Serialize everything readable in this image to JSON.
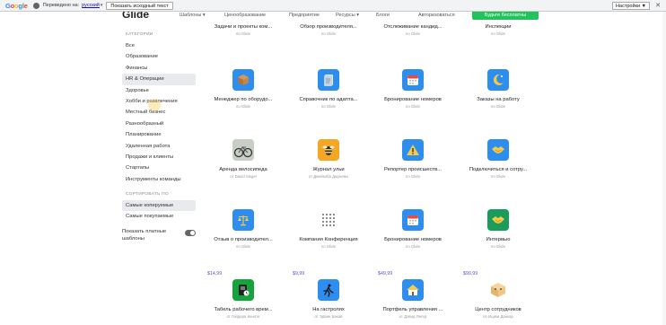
{
  "translate_bar": {
    "logo": [
      "G",
      "o",
      "o",
      "g",
      "l",
      "e"
    ],
    "status": "Переведено на:",
    "language": "русский",
    "show_original": "Показать исходный текст",
    "settings": "Настройки ▼",
    "close": "✕"
  },
  "nav": {
    "logo": "Glide",
    "items": [
      "Шаблоны ▾",
      "Ценообразование",
      "Предприятие",
      "Ресурсы ▾",
      "Блоги",
      "Авторизоваться"
    ],
    "cta": "Будьте бесплатны"
  },
  "sidebar": {
    "categories_heading": "КАТЕГОРИИ",
    "categories": [
      "Все",
      "Образование",
      "Финансы",
      "HR & Операции",
      "Здоровье",
      "Хобби и развлечения",
      "Местный бизнес",
      "Разнообразный",
      "Планирование",
      "Удаленная работа",
      "Продажи и клиенты",
      "Стартапы",
      "Инструменты команды"
    ],
    "active_category": "HR & Операции",
    "sort_heading": "СОРТИРОВАТЬ ПО",
    "sort_options": [
      "Самые копируемые",
      "Самые покупаемые"
    ],
    "active_sort": "Самые копируемые",
    "paid_toggle_label": "Показать платные шаблоны"
  },
  "rows": [
    {
      "cards": [
        {
          "title": "Задачи и проекты ком...",
          "author": "по Glide",
          "icon": "none"
        },
        {
          "title": "Обзор производителя...",
          "author": "по Glide",
          "icon": "none"
        },
        {
          "title": "Отслеживание кандид...",
          "author": "по Glide",
          "icon": "none"
        },
        {
          "title": "Инспекции",
          "author": "по Glide",
          "icon": "none"
        }
      ]
    },
    {
      "cards": [
        {
          "title": "Менеджер по оборудо...",
          "author": "по Glide",
          "icon": "box-icon",
          "color": "#2d8ef0"
        },
        {
          "title": "Справочник по адапта...",
          "author": "по Glide",
          "icon": "document-icon",
          "color": "#2d8ef0"
        },
        {
          "title": "Бронирование номеров",
          "author": "по Glide",
          "icon": "calendar-icon",
          "color": "#2d8ef0"
        },
        {
          "title": "Заказы на работу",
          "author": "по Glide",
          "icon": "moon-icon",
          "color": "#2d8ef0"
        }
      ]
    },
    {
      "cards": [
        {
          "title": "Аренда велосипеда",
          "author": "от David Siegel",
          "icon": "bicycle-photo-icon",
          "color": "#c7cfc5"
        },
        {
          "title": "Журнал ульи",
          "author": "от Джейкоба Джуневы",
          "icon": "bee-icon",
          "color": "#f5a623"
        },
        {
          "title": "Репортер происшеств...",
          "author": "по Glide",
          "icon": "warning-icon",
          "color": "#2d8ef0"
        },
        {
          "title": "Подключиться и сотру...",
          "author": "по Glide",
          "icon": "handshake-icon",
          "color": "#2d8ef0"
        }
      ]
    },
    {
      "cards": [
        {
          "title": "Отзыв о производител...",
          "author": "по Glide",
          "icon": "scales-icon",
          "color": "#2d8ef0"
        },
        {
          "title": "Компания Конференция",
          "author": "по Glide",
          "icon": "dots-grid-icon",
          "color": "#ffffff"
        },
        {
          "title": "Бронирование номеров",
          "author": "по Glide",
          "icon": "calendar-icon",
          "color": "#2d8ef0"
        },
        {
          "title": "Интервью",
          "author": "по Glide",
          "icon": "handshake-icon",
          "color": "#1a9c5a"
        }
      ],
      "prices": [
        "$14,99",
        "$9,99",
        "$49,99",
        "$99,99"
      ]
    },
    {
      "cards": [
        {
          "title": "Табель рабочего врем...",
          "author": "от Гойдера Кеноте",
          "icon": "timesheet-icon",
          "color": "#15a33b"
        },
        {
          "title": "На гастролях",
          "author": "от Эдвин Бакай",
          "icon": "runner-icon",
          "color": "#2d8ef0"
        },
        {
          "title": "Портфель управления ...",
          "author": "от Дэвид Янгер",
          "icon": "house-icon",
          "color": "#2d8ef0"
        },
        {
          "title": "Центр сотрудников",
          "author": "по Ицики Данкар",
          "icon": "isometric-icon",
          "color": "#ffffff"
        }
      ]
    }
  ]
}
